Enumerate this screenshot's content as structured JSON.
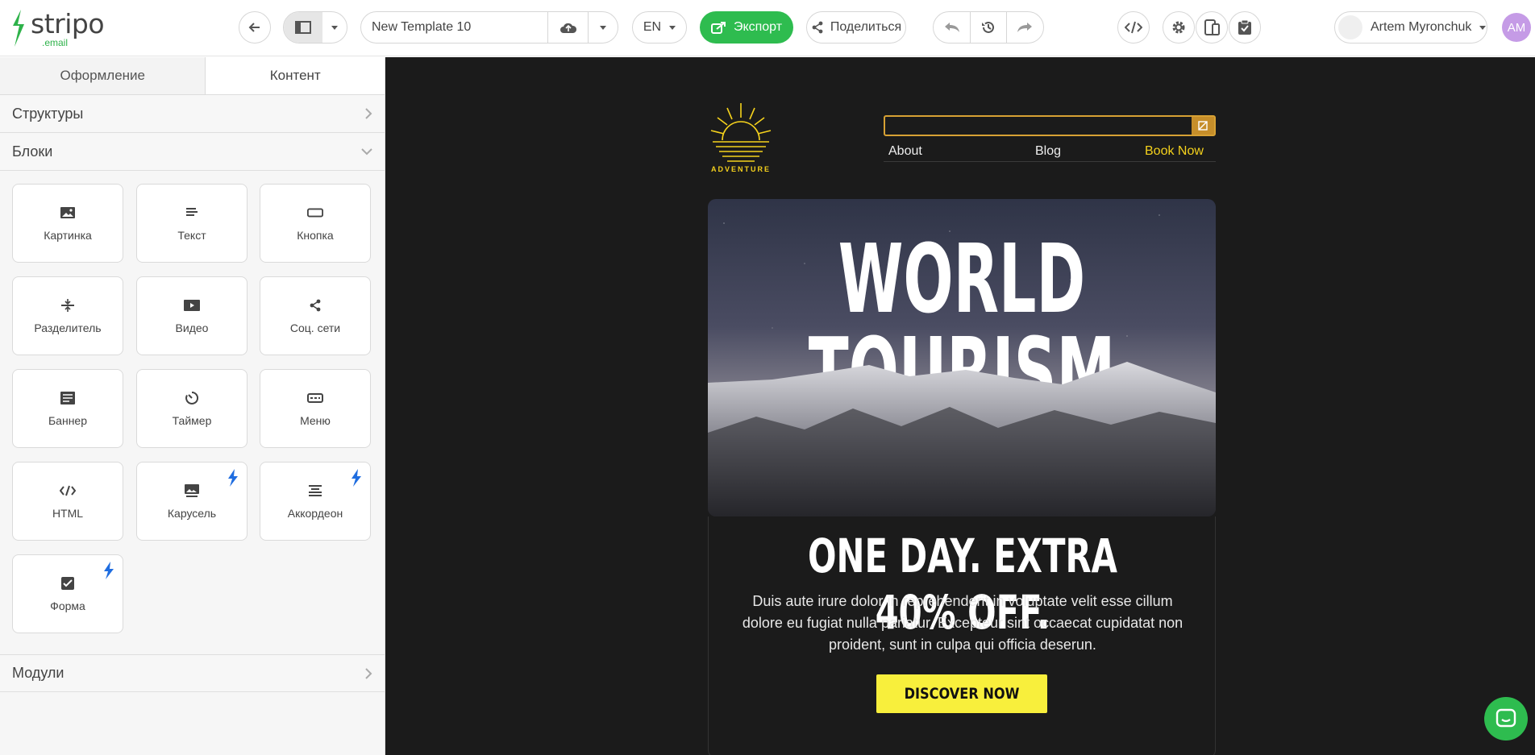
{
  "app": {
    "logo_word": "stripo",
    "logo_sub": ".email"
  },
  "toolbar": {
    "template_name": "New Template 10",
    "language": "EN",
    "export_label": "Экспорт",
    "share_label": "Поделиться",
    "user_name": "Artem Myronchuk",
    "avatar_initials": "AM",
    "accent_color": "#2ebc4f"
  },
  "sidebar": {
    "tabs": [
      {
        "label": "Оформление",
        "active": false
      },
      {
        "label": "Контент",
        "active": true
      }
    ],
    "sections": {
      "structures": "Структуры",
      "blocks": "Блоки",
      "modules": "Модули"
    },
    "blocks": [
      {
        "label": "Картинка",
        "icon": "image-icon",
        "amp": false
      },
      {
        "label": "Текст",
        "icon": "text-icon",
        "amp": false
      },
      {
        "label": "Кнопка",
        "icon": "button-icon",
        "amp": false
      },
      {
        "label": "Разделитель",
        "icon": "divider-icon",
        "amp": false
      },
      {
        "label": "Видео",
        "icon": "video-icon",
        "amp": false
      },
      {
        "label": "Соц. сети",
        "icon": "share-icon",
        "amp": false
      },
      {
        "label": "Баннер",
        "icon": "banner-icon",
        "amp": false
      },
      {
        "label": "Таймер",
        "icon": "timer-icon",
        "amp": false
      },
      {
        "label": "Меню",
        "icon": "menu-icon",
        "amp": false
      },
      {
        "label": "HTML",
        "icon": "code-icon",
        "amp": false
      },
      {
        "label": "Карусель",
        "icon": "carousel-icon",
        "amp": true
      },
      {
        "label": "Аккордеон",
        "icon": "accordion-icon",
        "amp": true
      },
      {
        "label": "Форма",
        "icon": "form-icon",
        "amp": true
      }
    ]
  },
  "email": {
    "brand_text": "ADVENTURE",
    "nav": [
      "About",
      "Blog",
      "Book Now"
    ],
    "hero_line1": "WORLD",
    "hero_line2": "TOURISM DAY",
    "offer": "ONE DAY. EXTRA 40% OFF.",
    "body": "Duis aute irure dolor in reprehenderit in voluptate velit esse cillum dolore eu fugiat nulla pariatur. Excepteur sint occaecat cupidatat non proident, sunt in culpa qui officia deserun.",
    "cta": "DISCOVER NOW",
    "brand_color": "#f5d21c",
    "cta_color": "#f8ef3c"
  }
}
